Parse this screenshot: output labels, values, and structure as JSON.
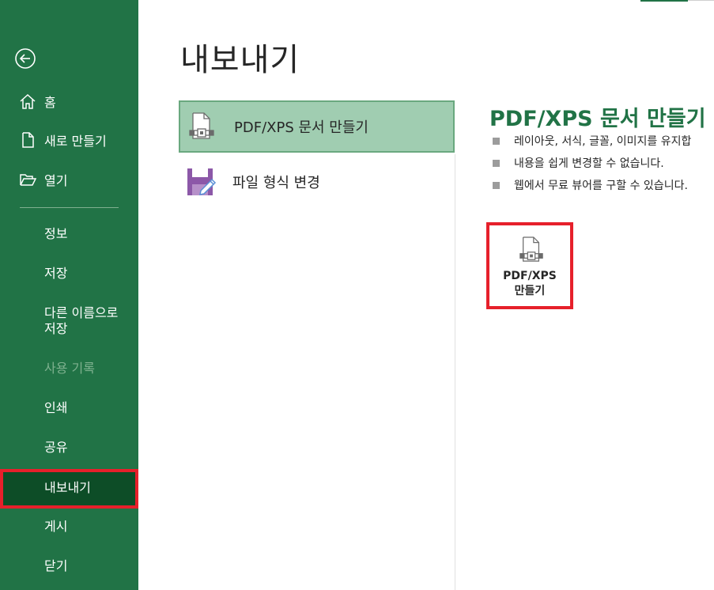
{
  "sidebar": {
    "home": "홈",
    "new": "새로 만들기",
    "open": "열기",
    "info": "정보",
    "save": "저장",
    "save_as_line1": "다른 이름으로",
    "save_as_line2": "저장",
    "history": "사용 기록",
    "print": "인쇄",
    "share": "공유",
    "export": "내보내기",
    "publish": "게시",
    "close": "닫기"
  },
  "main": {
    "title": "내보내기",
    "options": [
      {
        "label": "PDF/XPS 문서 만들기",
        "icon": "pdf-document-icon",
        "selected": true
      },
      {
        "label": "파일 형식 변경",
        "icon": "file-type-change-icon",
        "selected": false
      }
    ]
  },
  "detail": {
    "title": "PDF/XPS 문서 만들기",
    "bullets": [
      "레이아웃, 서식, 글꼴, 이미지를 유지합",
      "내용을 쉽게 변경할 수 없습니다.",
      "웹에서 무료 뷰어를 구할 수 있습니다."
    ],
    "button_line1": "PDF/XPS",
    "button_line2": "만들기"
  },
  "colors": {
    "sidebar_bg": "#217346",
    "selected_bg": "#0d4d27",
    "highlight_red": "#e6202b",
    "option_selected_bg": "#a0cdb1",
    "accent_green": "#217346"
  }
}
